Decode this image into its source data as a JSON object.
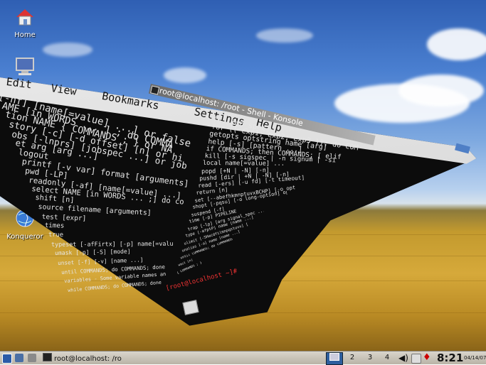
{
  "desktop": {
    "icons": [
      {
        "name": "home-icon",
        "label": "Home"
      },
      {
        "name": "computer-icon",
        "label": ""
      },
      {
        "name": "konqueror-icon",
        "label": "Konqueror"
      }
    ]
  },
  "konsole": {
    "title": "root@localhost: /root - Shell - Konsole",
    "menu": [
      "Edit",
      "View",
      "Bookmarks",
      "Settings",
      "Help"
    ],
    "lines_left": [
      "[-nf] [name[=value] ...] or false",
      "AME [in WORDS ... ] ; do COMMA",
      "tion NAME { COMMANDS ; } or NA",
      "story [-c] [-d offset] [n] or hi",
      "obs [-lnprs] [jobspec ...] or job",
      "et arg [arg ...]",
      "logout",
      "printf [-v var] format [arguments]",
      "pwd [-LP]",
      "readonly [-af] [name[=value] ...]",
      "select NAME [in WORDS ... ;] do co",
      "shift [n]",
      "source filename [arguments]",
      "test [expr]",
      "times",
      "true",
      "typeset [-afFirtx] [-p] name[=valu",
      "umask [-p] [-S] [mode]",
      "unset [-f] [-v] [name ...]",
      "until COMMANDS; do COMMANDS; done",
      "variables - Some variable names an",
      "while COMMANDS; do COMMANDS; done"
    ],
    "lines_right": [
      "fg [job_spec]",
      "for (( exp1; exp2; exp3 )); do COM",
      "getopts optstring name [arg]",
      "help [-s] [pattern ...]",
      "if COMMANDS; then COMMANDS; [ elif",
      "kill [-s sigspec | -n signum | -si",
      "local name[=value] ...",
      "popd [+N | -N] [-n]",
      "pushd [dir | +N | -N] [-n]",
      "read [-ers] [-u fd] [-t timeout]",
      "return [n]",
      "set [--abefhkmnptuvxBCHP] [-o opt]",
      "shopt [-pqsu] [-o long-option] opt",
      "suspend [-f]",
      "time [-p] PIPELINE",
      "trap [-lp] [arg signal_spec ...]",
      "type [-afptP] name [name ...]",
      "ulimit [-SHacdfilmnpqstuvx] [limit",
      "unalias [-a] name [name ...]",
      "until COMMANDS; do COMMANDS; done",
      "wait [n]",
      "{ COMMANDS ; }"
    ],
    "prompt": "[root@localhost ~]#"
  },
  "taskbar": {
    "task_label": "root@localhost: /ro",
    "pager": [
      "1",
      "2",
      "3",
      "4"
    ],
    "active_desktop": 0,
    "clock": "8:21",
    "date": "04/14/07"
  },
  "colors": {
    "sky_top": "#2f5fb3",
    "field": "#d6a93a",
    "terminal_bg": "#0c0c0c",
    "prompt": "#e33333",
    "pager_active": "#2d5e9e"
  }
}
